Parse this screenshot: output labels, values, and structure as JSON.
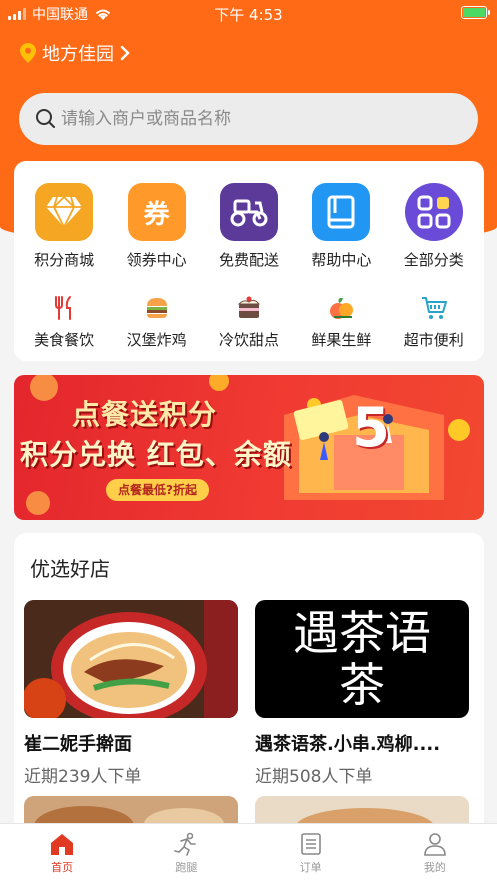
{
  "status": {
    "carrier": "中国联通",
    "time": "下午 4:53"
  },
  "location": {
    "name": "地方佳园"
  },
  "search": {
    "placeholder": "请输入商户或商品名称"
  },
  "categories_main": [
    {
      "label": "积分商城",
      "icon": "diamond-icon",
      "color": "#f5a623"
    },
    {
      "label": "领券中心",
      "icon": "coupon-icon",
      "color": "#ff9a2a",
      "glyph": "券"
    },
    {
      "label": "免费配送",
      "icon": "scooter-icon",
      "color": "#5b3a9a"
    },
    {
      "label": "帮助中心",
      "icon": "book-icon",
      "color": "#2196f3"
    },
    {
      "label": "全部分类",
      "icon": "grid-icon",
      "color": "#6a4bd8"
    }
  ],
  "categories_sub": [
    {
      "label": "美食餐饮",
      "icon": "fork-knife-icon"
    },
    {
      "label": "汉堡炸鸡",
      "icon": "burger-icon"
    },
    {
      "label": "冷饮甜点",
      "icon": "dessert-icon"
    },
    {
      "label": "鲜果生鲜",
      "icon": "fruit-icon"
    },
    {
      "label": "超市便利",
      "icon": "cart-icon"
    }
  ],
  "banner": {
    "line1": "点餐送积分",
    "line2": "积分兑换 红包、余额",
    "pill": "点餐最低?折起",
    "badge": "5"
  },
  "shops": {
    "title": "优选好店",
    "items": [
      {
        "name": "崔二妮手擀面",
        "sub": "近期239人下单"
      },
      {
        "name": "遇茶语茶.小串.鸡柳....",
        "sub": "近期508人下单",
        "logo_text": "遇茶语茶"
      }
    ]
  },
  "tabs": [
    {
      "label": "首页",
      "icon": "home-icon",
      "active": true
    },
    {
      "label": "跑腿",
      "icon": "runner-icon",
      "active": false
    },
    {
      "label": "订单",
      "icon": "order-list-icon",
      "active": false
    },
    {
      "label": "我的",
      "icon": "profile-icon",
      "active": false
    }
  ],
  "colors": {
    "brand": "#ff6a17",
    "active_tab": "#e03a22"
  }
}
